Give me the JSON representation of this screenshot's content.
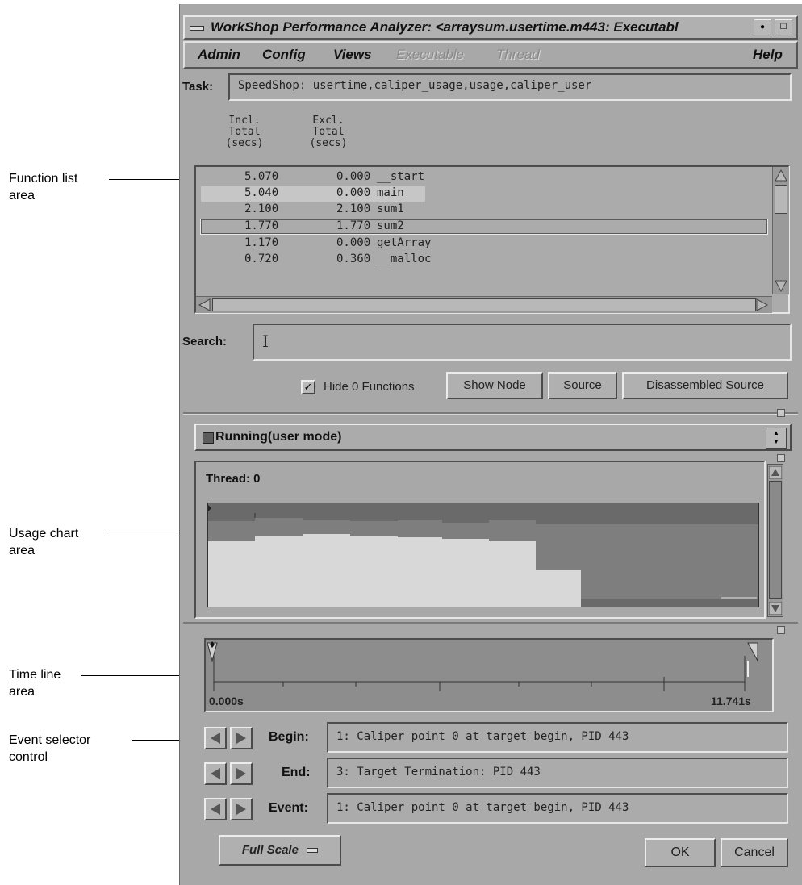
{
  "callouts": {
    "function_list": [
      "Function list",
      "area"
    ],
    "usage_chart": [
      "Usage chart",
      "area"
    ],
    "time_line": [
      "Time line",
      "area"
    ],
    "event_selector": [
      "Event selector",
      "control"
    ]
  },
  "window": {
    "title": "WorkShop Performance Analyzer: <arraysum.usertime.m443: Executabl"
  },
  "menubar": {
    "admin": "Admin",
    "config": "Config",
    "views": "Views",
    "executable": "Executable",
    "thread": "Thread",
    "help": "Help"
  },
  "task": {
    "label": "Task:",
    "value": "SpeedShop: usertime,caliper_usage,usage,caliper_user"
  },
  "columns": {
    "incl": "Incl.\nTotal\n(secs)",
    "excl": "Excl.\nTotal\n(secs)"
  },
  "functions": [
    {
      "incl": "5.070",
      "excl": "0.000",
      "name": "__start"
    },
    {
      "incl": "5.040",
      "excl": "0.000",
      "name": "main"
    },
    {
      "incl": "2.100",
      "excl": "2.100",
      "name": "sum1"
    },
    {
      "incl": "1.770",
      "excl": "1.770",
      "name": "sum2"
    },
    {
      "incl": "1.170",
      "excl": "0.000",
      "name": "getArray"
    },
    {
      "incl": "0.720",
      "excl": "0.360",
      "name": "__malloc"
    }
  ],
  "search": {
    "label": "Search:",
    "value": "I"
  },
  "controls": {
    "hide_zero": "Hide 0 Functions",
    "show_node": "Show Node",
    "source": "Source",
    "disassembled": "Disassembled Source"
  },
  "usage": {
    "mode": "Running(user mode)",
    "thread_label": "Thread: 0"
  },
  "timeline": {
    "start": "0.000s",
    "end": "11.741s"
  },
  "events": {
    "begin_label": "Begin:",
    "begin_value": "1: Caliper point 0 at target begin, PID 443",
    "end_label": "End:",
    "end_value": "3: Target Termination: PID 443",
    "event_label": "Event:",
    "event_value": "1: Caliper point 0 at target begin, PID 443"
  },
  "footer": {
    "full_scale": "Full Scale",
    "ok": "OK",
    "cancel": "Cancel"
  }
}
